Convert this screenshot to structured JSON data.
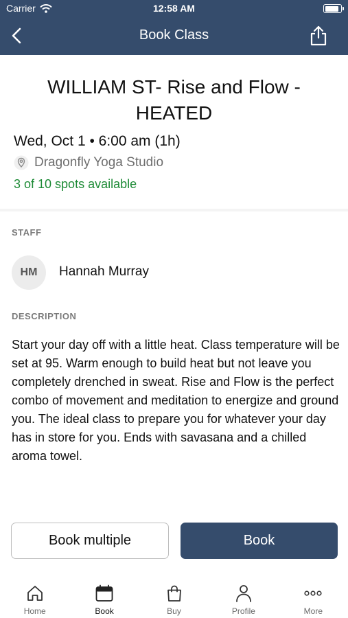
{
  "status_bar": {
    "carrier": "Carrier",
    "time": "12:58 AM",
    "battery_level": 0.95
  },
  "nav": {
    "title": "Book Class",
    "back_icon": "chevron-left-icon",
    "share_icon": "share-icon"
  },
  "class_info": {
    "title": "WILLIAM ST- Rise and Flow - HEATED",
    "datetime": "Wed, Oct 1 • 6:00 am (1h)",
    "location": "Dragonfly Yoga Studio",
    "spots": "3 of 10 spots available"
  },
  "staff": {
    "label": "STAFF",
    "initials": "HM",
    "name": "Hannah Murray"
  },
  "description": {
    "label": "DESCRIPTION",
    "text": "Start your day off with a little heat.  Class temperature will be set at 95. Warm enough to build heat but not leave you completely drenched in sweat.  Rise and Flow is the perfect combo of movement and meditation to energize and ground you.  The ideal class to prepare you for whatever your day has in store for you.  Ends with savasana and a chilled aroma towel."
  },
  "actions": {
    "book_multiple": "Book multiple",
    "book": "Book"
  },
  "tabs": [
    {
      "label": "Home",
      "icon": "home-icon"
    },
    {
      "label": "Book",
      "icon": "calendar-icon",
      "active": true
    },
    {
      "label": "Buy",
      "icon": "shopping-bag-icon"
    },
    {
      "label": "Profile",
      "icon": "person-icon"
    },
    {
      "label": "More",
      "icon": "more-dots-icon"
    }
  ],
  "colors": {
    "primary": "#354c6c",
    "available": "#1c8a35",
    "muted": "#7a7a7a"
  }
}
